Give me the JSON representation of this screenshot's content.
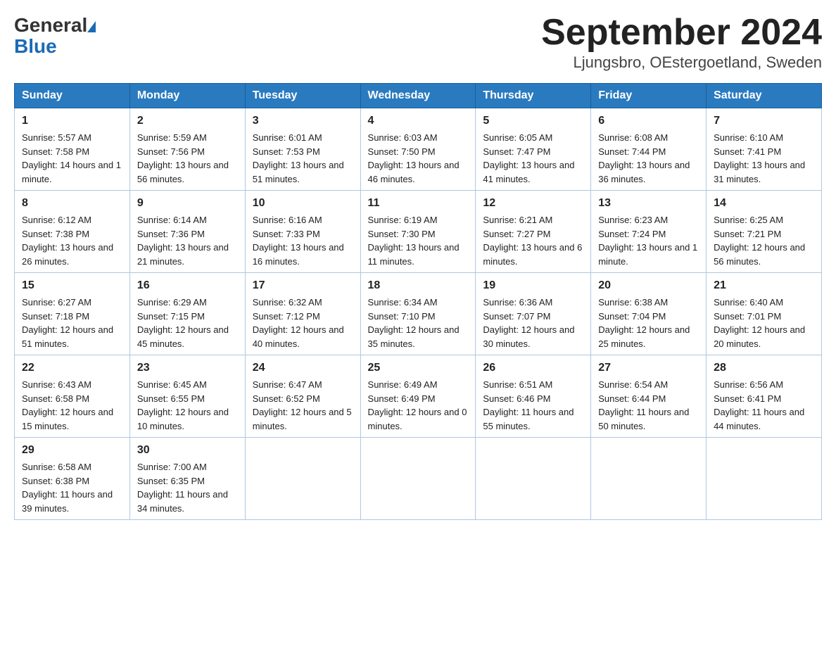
{
  "header": {
    "month_title": "September 2024",
    "location": "Ljungsbro, OEstergoetland, Sweden"
  },
  "logo": {
    "general": "General",
    "blue": "Blue"
  },
  "days_of_week": [
    "Sunday",
    "Monday",
    "Tuesday",
    "Wednesday",
    "Thursday",
    "Friday",
    "Saturday"
  ],
  "weeks": [
    [
      {
        "day": "1",
        "sunrise": "Sunrise: 5:57 AM",
        "sunset": "Sunset: 7:58 PM",
        "daylight": "Daylight: 14 hours and 1 minute."
      },
      {
        "day": "2",
        "sunrise": "Sunrise: 5:59 AM",
        "sunset": "Sunset: 7:56 PM",
        "daylight": "Daylight: 13 hours and 56 minutes."
      },
      {
        "day": "3",
        "sunrise": "Sunrise: 6:01 AM",
        "sunset": "Sunset: 7:53 PM",
        "daylight": "Daylight: 13 hours and 51 minutes."
      },
      {
        "day": "4",
        "sunrise": "Sunrise: 6:03 AM",
        "sunset": "Sunset: 7:50 PM",
        "daylight": "Daylight: 13 hours and 46 minutes."
      },
      {
        "day": "5",
        "sunrise": "Sunrise: 6:05 AM",
        "sunset": "Sunset: 7:47 PM",
        "daylight": "Daylight: 13 hours and 41 minutes."
      },
      {
        "day": "6",
        "sunrise": "Sunrise: 6:08 AM",
        "sunset": "Sunset: 7:44 PM",
        "daylight": "Daylight: 13 hours and 36 minutes."
      },
      {
        "day": "7",
        "sunrise": "Sunrise: 6:10 AM",
        "sunset": "Sunset: 7:41 PM",
        "daylight": "Daylight: 13 hours and 31 minutes."
      }
    ],
    [
      {
        "day": "8",
        "sunrise": "Sunrise: 6:12 AM",
        "sunset": "Sunset: 7:38 PM",
        "daylight": "Daylight: 13 hours and 26 minutes."
      },
      {
        "day": "9",
        "sunrise": "Sunrise: 6:14 AM",
        "sunset": "Sunset: 7:36 PM",
        "daylight": "Daylight: 13 hours and 21 minutes."
      },
      {
        "day": "10",
        "sunrise": "Sunrise: 6:16 AM",
        "sunset": "Sunset: 7:33 PM",
        "daylight": "Daylight: 13 hours and 16 minutes."
      },
      {
        "day": "11",
        "sunrise": "Sunrise: 6:19 AM",
        "sunset": "Sunset: 7:30 PM",
        "daylight": "Daylight: 13 hours and 11 minutes."
      },
      {
        "day": "12",
        "sunrise": "Sunrise: 6:21 AM",
        "sunset": "Sunset: 7:27 PM",
        "daylight": "Daylight: 13 hours and 6 minutes."
      },
      {
        "day": "13",
        "sunrise": "Sunrise: 6:23 AM",
        "sunset": "Sunset: 7:24 PM",
        "daylight": "Daylight: 13 hours and 1 minute."
      },
      {
        "day": "14",
        "sunrise": "Sunrise: 6:25 AM",
        "sunset": "Sunset: 7:21 PM",
        "daylight": "Daylight: 12 hours and 56 minutes."
      }
    ],
    [
      {
        "day": "15",
        "sunrise": "Sunrise: 6:27 AM",
        "sunset": "Sunset: 7:18 PM",
        "daylight": "Daylight: 12 hours and 51 minutes."
      },
      {
        "day": "16",
        "sunrise": "Sunrise: 6:29 AM",
        "sunset": "Sunset: 7:15 PM",
        "daylight": "Daylight: 12 hours and 45 minutes."
      },
      {
        "day": "17",
        "sunrise": "Sunrise: 6:32 AM",
        "sunset": "Sunset: 7:12 PM",
        "daylight": "Daylight: 12 hours and 40 minutes."
      },
      {
        "day": "18",
        "sunrise": "Sunrise: 6:34 AM",
        "sunset": "Sunset: 7:10 PM",
        "daylight": "Daylight: 12 hours and 35 minutes."
      },
      {
        "day": "19",
        "sunrise": "Sunrise: 6:36 AM",
        "sunset": "Sunset: 7:07 PM",
        "daylight": "Daylight: 12 hours and 30 minutes."
      },
      {
        "day": "20",
        "sunrise": "Sunrise: 6:38 AM",
        "sunset": "Sunset: 7:04 PM",
        "daylight": "Daylight: 12 hours and 25 minutes."
      },
      {
        "day": "21",
        "sunrise": "Sunrise: 6:40 AM",
        "sunset": "Sunset: 7:01 PM",
        "daylight": "Daylight: 12 hours and 20 minutes."
      }
    ],
    [
      {
        "day": "22",
        "sunrise": "Sunrise: 6:43 AM",
        "sunset": "Sunset: 6:58 PM",
        "daylight": "Daylight: 12 hours and 15 minutes."
      },
      {
        "day": "23",
        "sunrise": "Sunrise: 6:45 AM",
        "sunset": "Sunset: 6:55 PM",
        "daylight": "Daylight: 12 hours and 10 minutes."
      },
      {
        "day": "24",
        "sunrise": "Sunrise: 6:47 AM",
        "sunset": "Sunset: 6:52 PM",
        "daylight": "Daylight: 12 hours and 5 minutes."
      },
      {
        "day": "25",
        "sunrise": "Sunrise: 6:49 AM",
        "sunset": "Sunset: 6:49 PM",
        "daylight": "Daylight: 12 hours and 0 minutes."
      },
      {
        "day": "26",
        "sunrise": "Sunrise: 6:51 AM",
        "sunset": "Sunset: 6:46 PM",
        "daylight": "Daylight: 11 hours and 55 minutes."
      },
      {
        "day": "27",
        "sunrise": "Sunrise: 6:54 AM",
        "sunset": "Sunset: 6:44 PM",
        "daylight": "Daylight: 11 hours and 50 minutes."
      },
      {
        "day": "28",
        "sunrise": "Sunrise: 6:56 AM",
        "sunset": "Sunset: 6:41 PM",
        "daylight": "Daylight: 11 hours and 44 minutes."
      }
    ],
    [
      {
        "day": "29",
        "sunrise": "Sunrise: 6:58 AM",
        "sunset": "Sunset: 6:38 PM",
        "daylight": "Daylight: 11 hours and 39 minutes."
      },
      {
        "day": "30",
        "sunrise": "Sunrise: 7:00 AM",
        "sunset": "Sunset: 6:35 PM",
        "daylight": "Daylight: 11 hours and 34 minutes."
      },
      {
        "day": "",
        "sunrise": "",
        "sunset": "",
        "daylight": ""
      },
      {
        "day": "",
        "sunrise": "",
        "sunset": "",
        "daylight": ""
      },
      {
        "day": "",
        "sunrise": "",
        "sunset": "",
        "daylight": ""
      },
      {
        "day": "",
        "sunrise": "",
        "sunset": "",
        "daylight": ""
      },
      {
        "day": "",
        "sunrise": "",
        "sunset": "",
        "daylight": ""
      }
    ]
  ]
}
